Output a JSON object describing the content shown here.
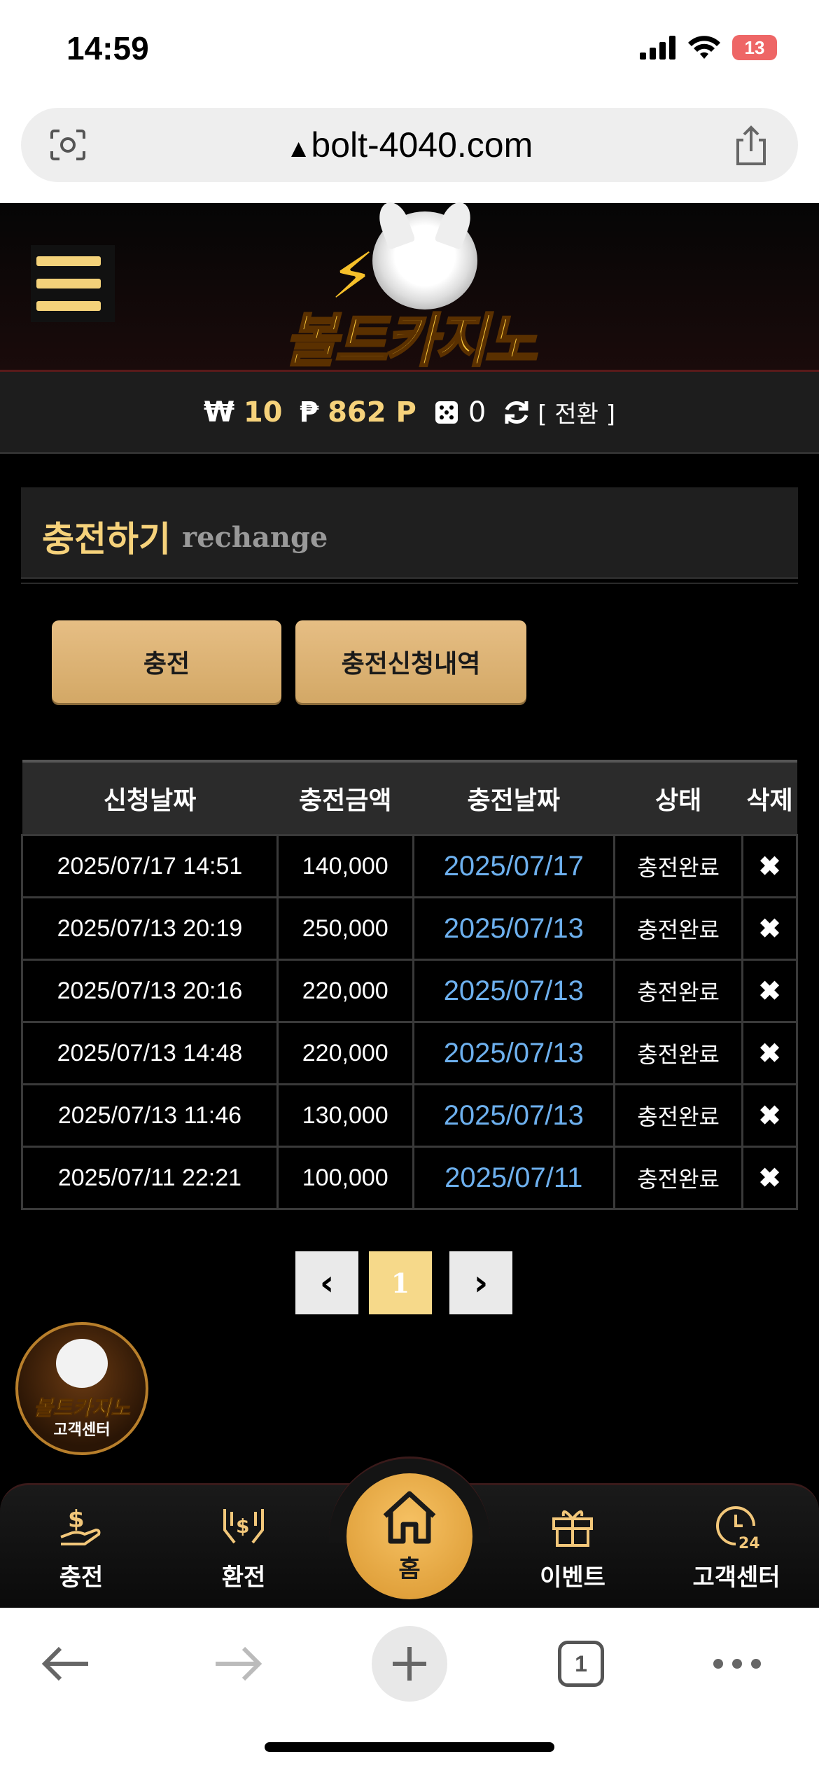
{
  "status_bar": {
    "time": "14:59",
    "battery": "13"
  },
  "browser": {
    "url": "bolt-4040.com"
  },
  "header": {
    "logo_text": "볼트카지노"
  },
  "balance": {
    "won_symbol": "₩",
    "won": "10",
    "point_symbol": "₱",
    "points": "862 P",
    "chips": "0",
    "switch_label": "[ 전환 ]"
  },
  "section": {
    "title": "충전하기",
    "subtitle": "rechange"
  },
  "buttons": {
    "charge": "충전",
    "history": "충전신청내역"
  },
  "table": {
    "headers": [
      "신청날짜",
      "충전금액",
      "충전날짜",
      "상태",
      "삭제"
    ],
    "rows": [
      {
        "requested": "2025/07/17 14:51",
        "amount": "140,000",
        "charged": "2025/07/17",
        "status": "충전완료"
      },
      {
        "requested": "2025/07/13 20:19",
        "amount": "250,000",
        "charged": "2025/07/13",
        "status": "충전완료"
      },
      {
        "requested": "2025/07/13 20:16",
        "amount": "220,000",
        "charged": "2025/07/13",
        "status": "충전완료"
      },
      {
        "requested": "2025/07/13 14:48",
        "amount": "220,000",
        "charged": "2025/07/13",
        "status": "충전완료"
      },
      {
        "requested": "2025/07/13 11:46",
        "amount": "130,000",
        "charged": "2025/07/13",
        "status": "충전완료"
      },
      {
        "requested": "2025/07/11 22:21",
        "amount": "100,000",
        "charged": "2025/07/11",
        "status": "충전완료"
      }
    ],
    "delete_symbol": "✖"
  },
  "pagination": {
    "prev": "‹",
    "current": "1",
    "next": "›"
  },
  "support_badge": {
    "logo": "볼트카지노",
    "label": "고객센터"
  },
  "bottom_nav": {
    "charge": "충전",
    "exchange": "환전",
    "home": "홈",
    "event": "이벤트",
    "support": "고객센터"
  },
  "toolbar": {
    "tab_count": "1"
  },
  "colors": {
    "gold": "#f6d27b",
    "link": "#6db0ee",
    "button": "#e2b978"
  }
}
